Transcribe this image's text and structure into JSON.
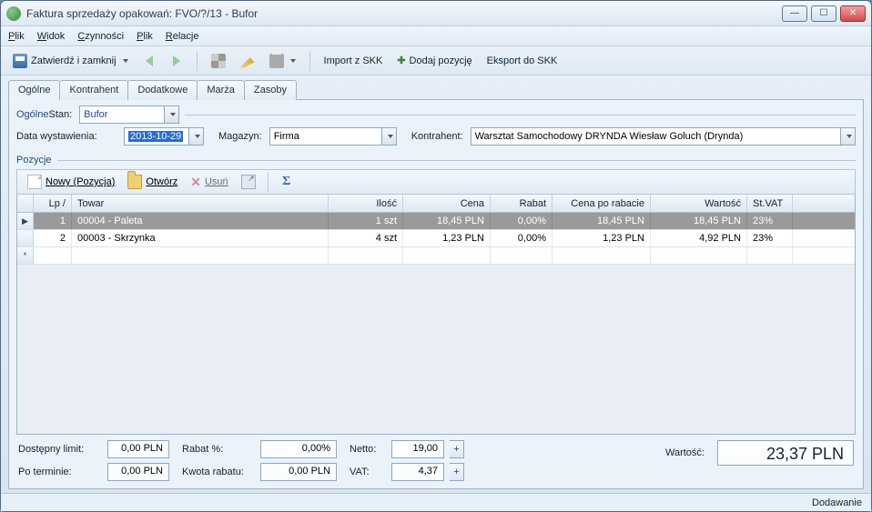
{
  "window": {
    "title": "Faktura sprzedaży opakowań: FVO/?/13 - Bufor"
  },
  "menu": {
    "plik1": "Plik",
    "widok": "Widok",
    "czynnosci": "Czynności",
    "plik2": "Plik",
    "relacje": "Relacje"
  },
  "toolbar": {
    "zatwierdz": "Zatwierdź i zamknij",
    "import": "Import z SKK",
    "dodaj": "Dodaj pozycję",
    "eksport": "Eksport do SKK"
  },
  "tabs": {
    "ogolne": "Ogólne",
    "kontrahent": "Kontrahent",
    "dodatkowe": "Dodatkowe",
    "marza": "Marża",
    "zasoby": "Zasoby"
  },
  "section": {
    "ogolne": "Ogólne",
    "pozycje": "Pozycje"
  },
  "fields": {
    "stan_label": "Stan:",
    "stan_value": "Bufor",
    "data_label": "Data wystawienia:",
    "data_value": "2013-10-29",
    "magazyn_label": "Magazyn:",
    "magazyn_value": "Firma",
    "kontrahent_label": "Kontrahent:",
    "kontrahent_value": "Warsztat Samochodowy DRYNDA Wiesław Goluch  (Drynda)"
  },
  "poz_toolbar": {
    "nowy": "Nowy (Pozycja)",
    "otworz": "Otwórz",
    "usun": "Usuń"
  },
  "grid": {
    "headers": {
      "lp": "Lp",
      "towar": "Towar",
      "ilosc": "Ilość",
      "cena": "Cena",
      "rabat": "Rabat",
      "cenarab": "Cena po rabacie",
      "wartosc": "Wartość",
      "vat": "St.VAT"
    },
    "rows": [
      {
        "lp": "1",
        "towar": "00004 - Paleta",
        "ilosc": "1 szt",
        "cena": "18,45 PLN",
        "rabat": "0,00%",
        "cenarab": "18,45 PLN",
        "wartosc": "18,45 PLN",
        "vat": "23%"
      },
      {
        "lp": "2",
        "towar": "00003 - Skrzynka",
        "ilosc": "4 szt",
        "cena": "1,23 PLN",
        "rabat": "0,00%",
        "cenarab": "1,23 PLN",
        "wartosc": "4,92 PLN",
        "vat": "23%"
      }
    ]
  },
  "bottom": {
    "dostepny_label": "Dostępny limit:",
    "dostepny_val": "0,00 PLN",
    "poterminie_label": "Po terminie:",
    "poterminie_val": "0,00 PLN",
    "rabatp_label": "Rabat %:",
    "rabatp_val": "0,00%",
    "kwota_label": "Kwota rabatu:",
    "kwota_val": "0,00 PLN",
    "netto_label": "Netto:",
    "netto_val": "19,00",
    "vat_label": "VAT:",
    "vat_val": "4,37",
    "wartosc_label": "Wartość:",
    "wartosc_val": "23,37 PLN"
  },
  "status": {
    "text": "Dodawanie"
  }
}
